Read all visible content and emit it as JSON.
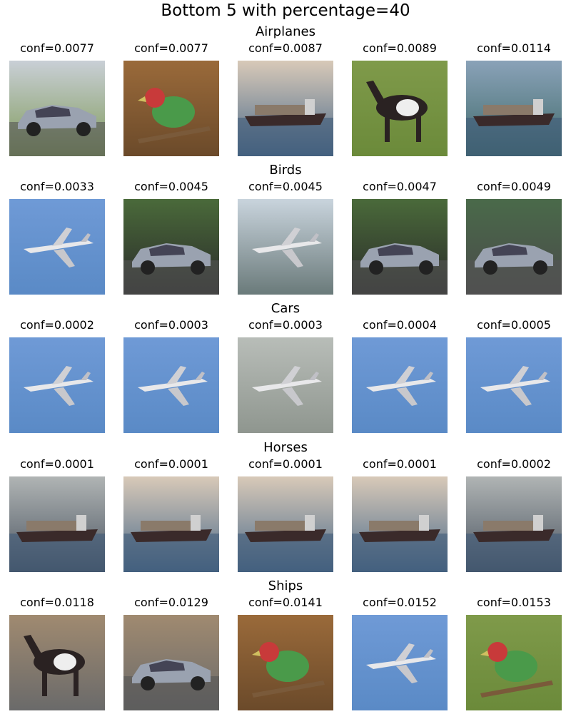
{
  "title": "Bottom 5 with percentage=40",
  "rows": [
    {
      "label": "Airplanes",
      "items": [
        {
          "conf": "conf=0.0077",
          "subject": "car",
          "scene": "park"
        },
        {
          "conf": "conf=0.0077",
          "subject": "bird",
          "scene": "branch"
        },
        {
          "conf": "conf=0.0087",
          "subject": "ship",
          "scene": "sea"
        },
        {
          "conf": "conf=0.0089",
          "subject": "horse",
          "scene": "grass"
        },
        {
          "conf": "conf=0.0114",
          "subject": "ship",
          "scene": "harbor"
        }
      ]
    },
    {
      "label": "Birds",
      "items": [
        {
          "conf": "conf=0.0033",
          "subject": "airplane",
          "scene": "sky"
        },
        {
          "conf": "conf=0.0045",
          "subject": "car",
          "scene": "road"
        },
        {
          "conf": "conf=0.0045",
          "subject": "airplane",
          "scene": "lake"
        },
        {
          "conf": "conf=0.0047",
          "subject": "car",
          "scene": "road"
        },
        {
          "conf": "conf=0.0049",
          "subject": "car",
          "scene": "track"
        }
      ]
    },
    {
      "label": "Cars",
      "items": [
        {
          "conf": "conf=0.0002",
          "subject": "airplane",
          "scene": "sky"
        },
        {
          "conf": "conf=0.0003",
          "subject": "airplane",
          "scene": "sky"
        },
        {
          "conf": "conf=0.0003",
          "subject": "airplane",
          "scene": "water"
        },
        {
          "conf": "conf=0.0004",
          "subject": "airplane",
          "scene": "sky"
        },
        {
          "conf": "conf=0.0005",
          "subject": "airplane",
          "scene": "sky"
        }
      ]
    },
    {
      "label": "Horses",
      "items": [
        {
          "conf": "conf=0.0001",
          "subject": "ship",
          "scene": "fog"
        },
        {
          "conf": "conf=0.0001",
          "subject": "ship",
          "scene": "sea"
        },
        {
          "conf": "conf=0.0001",
          "subject": "ship",
          "scene": "sea"
        },
        {
          "conf": "conf=0.0001",
          "subject": "ship",
          "scene": "sea"
        },
        {
          "conf": "conf=0.0002",
          "subject": "ship",
          "scene": "fog"
        }
      ]
    },
    {
      "label": "Ships",
      "items": [
        {
          "conf": "conf=0.0118",
          "subject": "horse",
          "scene": "street"
        },
        {
          "conf": "conf=0.0129",
          "subject": "car",
          "scene": "street"
        },
        {
          "conf": "conf=0.0141",
          "subject": "bird",
          "scene": "branch"
        },
        {
          "conf": "conf=0.0152",
          "subject": "airplane",
          "scene": "sky"
        },
        {
          "conf": "conf=0.0153",
          "subject": "bird",
          "scene": "grass"
        }
      ]
    }
  ]
}
